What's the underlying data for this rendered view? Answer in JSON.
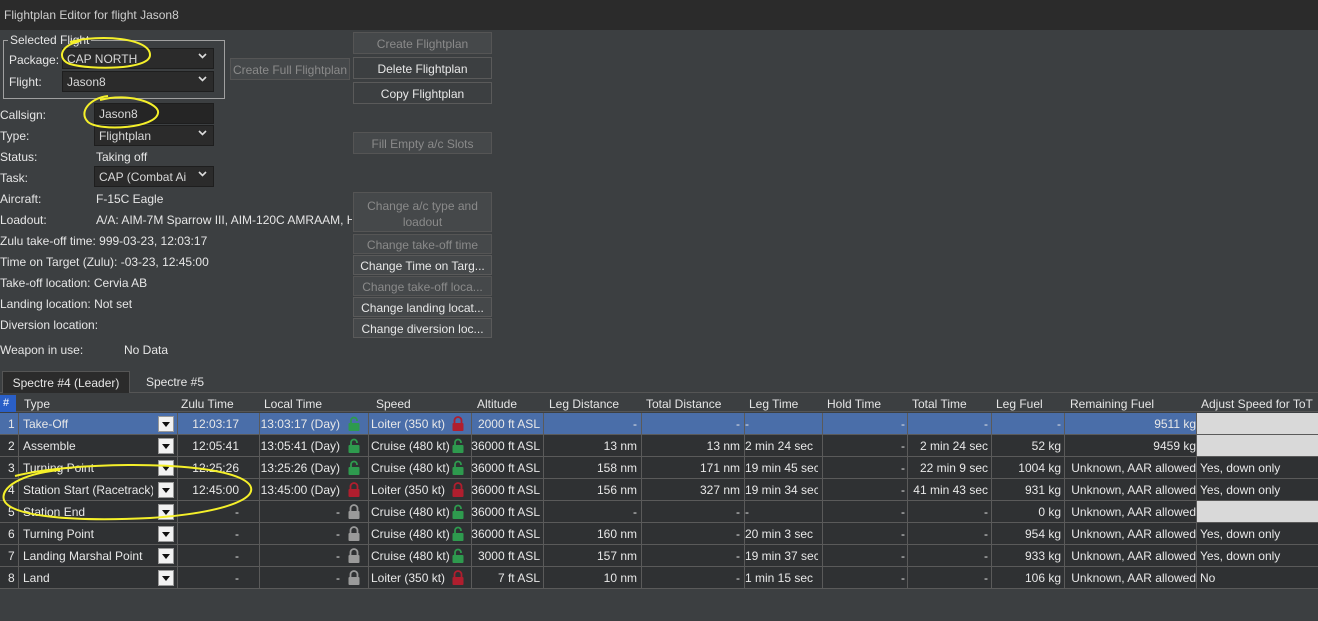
{
  "window": {
    "title": "Flightplan Editor for flight Jason8"
  },
  "selected_flight": {
    "title": "Selected Flight",
    "package_label": "Package:",
    "package_value": "CAP NORTH",
    "flight_label": "Flight:",
    "flight_value": "Jason8"
  },
  "fields": {
    "callsign_label": "Callsign:",
    "callsign_value": "Jason8",
    "type_label": "Type:",
    "type_value": "Flightplan",
    "status_label": "Status:",
    "status_value": "Taking off",
    "task_label": "Task:",
    "task_value": "CAP (Combat Ai",
    "aircraft_label": "Aircraft:",
    "aircraft_value": "F-15C Eagle",
    "loadout_label": "Loadout:",
    "loadout_value": "A/A: AIM-7M Sparrow III, AIM-120C AMRAAM, H",
    "zulu_takeoff": "Zulu take-off time: 999-03-23, 12:03:17",
    "tot": "Time on Target (Zulu): -03-23, 12:45:00",
    "takeoff_loc": "Take-off location: Cervia AB",
    "landing_loc": "Landing location: Not set",
    "diversion_loc": "Diversion location:",
    "weapon_label": "Weapon in use:",
    "weapon_value": "No Data"
  },
  "buttons": {
    "create_full": "Create Full Flightplan",
    "create": "Create Flightplan",
    "delete": "Delete Flightplan",
    "copy": "Copy Flightplan",
    "fill_empty": "Fill Empty a/c Slots",
    "change_type_1": "Change a/c type and",
    "change_type_2": "loadout",
    "change_takeoff_time": "Change take-off time",
    "change_tot": "Change  Time  on  Targ...",
    "change_takeoff_loc": "Change  take-off  loca...",
    "change_landing_loc": "Change  landing  locat...",
    "change_diversion_loc": "Change  diversion  loc..."
  },
  "tabs": [
    "Spectre #4 (Leader)",
    "Spectre #5"
  ],
  "table": {
    "corner": "#",
    "headers": [
      "Type",
      "Zulu Time",
      "Local Time",
      "Speed",
      "Altitude",
      "Leg Distance",
      "Total Distance",
      "Leg Time",
      "Hold Time",
      "Total Time",
      "Leg Fuel",
      "Remaining Fuel",
      "Adjust Speed for ToT"
    ],
    "rows": [
      {
        "n": "1",
        "type": "Take-Off",
        "zulu": "12:03:17",
        "local": "13:03:17 (Day)",
        "lock1": "green",
        "speed": "Loiter (350 kt)",
        "lock2": "red",
        "alt": "2000 ft ASL",
        "legdist": "-",
        "totdist": "-",
        "legtime": "-",
        "hold": "-",
        "tottime": "-",
        "legfuel": "-",
        "remfuel": "9511 kg",
        "adjust": "",
        "adjust_gray": true
      },
      {
        "n": "2",
        "type": "Assemble",
        "zulu": "12:05:41",
        "local": "13:05:41 (Day)",
        "lock1": "green",
        "speed": "Cruise (480 kt)",
        "lock2": "green",
        "alt": "36000 ft ASL",
        "legdist": "13 nm",
        "totdist": "13 nm",
        "legtime": "2 min 24 sec",
        "hold": "-",
        "tottime": "2 min 24 sec",
        "legfuel": "52 kg",
        "remfuel": "9459 kg",
        "adjust": "",
        "adjust_gray": true
      },
      {
        "n": "3",
        "type": "Turning Point",
        "zulu": "12:25:26",
        "local": "13:25:26 (Day)",
        "lock1": "green",
        "speed": "Cruise (480 kt)",
        "lock2": "green",
        "alt": "36000 ft ASL",
        "legdist": "158 nm",
        "totdist": "171 nm",
        "legtime": "19 min 45 sec",
        "hold": "-",
        "tottime": "22 min 9 sec",
        "legfuel": "1004 kg",
        "remfuel": "Unknown, AAR allowed",
        "adjust": "Yes, down only",
        "adjust_gray": false
      },
      {
        "n": "4",
        "type": "Station Start (Racetrack)",
        "zulu": "12:45:00",
        "local": "13:45:00 (Day)",
        "lock1": "red",
        "speed": "Loiter (350 kt)",
        "lock2": "red",
        "alt": "36000 ft ASL",
        "legdist": "156 nm",
        "totdist": "327 nm",
        "legtime": "19 min 34 sec",
        "hold": "-",
        "tottime": "41 min 43 sec",
        "legfuel": "931 kg",
        "remfuel": "Unknown, AAR allowed",
        "adjust": "Yes, down only",
        "adjust_gray": false
      },
      {
        "n": "5",
        "type": "Station End",
        "zulu": "-",
        "local": "-",
        "lock1": "gray",
        "speed": "Cruise (480 kt)",
        "lock2": "green",
        "alt": "36000 ft ASL",
        "legdist": "-",
        "totdist": "-",
        "legtime": "-",
        "hold": "-",
        "tottime": "-",
        "legfuel": "0 kg",
        "remfuel": "Unknown, AAR allowed",
        "adjust": "",
        "adjust_gray": true
      },
      {
        "n": "6",
        "type": "Turning Point",
        "zulu": "-",
        "local": "-",
        "lock1": "gray",
        "speed": "Cruise (480 kt)",
        "lock2": "green",
        "alt": "36000 ft ASL",
        "legdist": "160 nm",
        "totdist": "-",
        "legtime": "20 min 3 sec",
        "hold": "-",
        "tottime": "-",
        "legfuel": "954 kg",
        "remfuel": "Unknown, AAR allowed",
        "adjust": "Yes, down only",
        "adjust_gray": false
      },
      {
        "n": "7",
        "type": "Landing Marshal Point",
        "zulu": "-",
        "local": "-",
        "lock1": "gray",
        "speed": "Cruise (480 kt)",
        "lock2": "green",
        "alt": "3000 ft ASL",
        "legdist": "157 nm",
        "totdist": "-",
        "legtime": "19 min 37 sec",
        "hold": "-",
        "tottime": "-",
        "legfuel": "933 kg",
        "remfuel": "Unknown, AAR allowed",
        "adjust": "Yes, down only",
        "adjust_gray": false
      },
      {
        "n": "8",
        "type": "Land",
        "zulu": "-",
        "local": "-",
        "lock1": "gray",
        "speed": "Loiter (350 kt)",
        "lock2": "red",
        "alt": "7 ft ASL",
        "legdist": "10 nm",
        "totdist": "-",
        "legtime": "1 min 15 sec",
        "hold": "-",
        "tottime": "-",
        "legfuel": "106 kg",
        "remfuel": "Unknown, AAR allowed",
        "adjust": "No",
        "adjust_gray": false
      }
    ]
  },
  "colors": {
    "lock_green": "#2e9a4e",
    "lock_red": "#b01e2e",
    "lock_gray": "#9a9a9a",
    "selection": "#4a6ea9",
    "annotation": "#f5f02a"
  }
}
